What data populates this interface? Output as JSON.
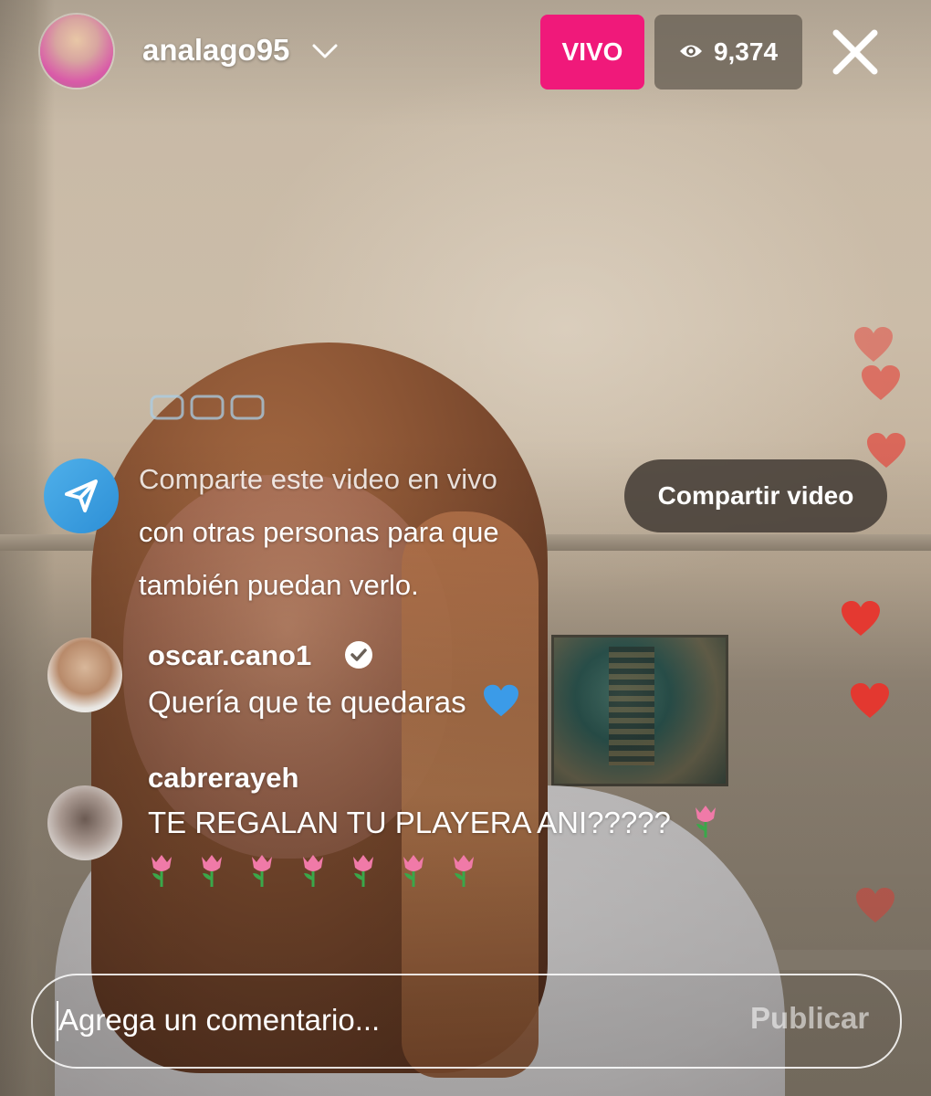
{
  "header": {
    "username": "analago95",
    "live_label": "VIVO",
    "viewer_count": "9,374"
  },
  "share_prompt": {
    "lines": [
      "Comparte este video en vivo",
      "con otras personas para que",
      "también puedan verlo."
    ],
    "button_label": "Compartir video"
  },
  "comments": [
    {
      "username": "oscar.cano1",
      "verified": true,
      "text": "Quería que te quedaras",
      "emoji": "blue-heart-icon"
    },
    {
      "username": "cabrerayeh",
      "verified": false,
      "text": "TE REGALAN TU PLAYERA ANI?????",
      "emoji": "tulip-icon",
      "extra_emoji_count": 7
    }
  ],
  "comment_input": {
    "placeholder": "Agrega un comentario...",
    "value": "",
    "publish_label": "Publicar"
  },
  "colors": {
    "live_badge": "#f0197a",
    "heart": "#e8352d",
    "share_icon": "#3a9fe0",
    "blue_heart": "#3b9be8"
  }
}
